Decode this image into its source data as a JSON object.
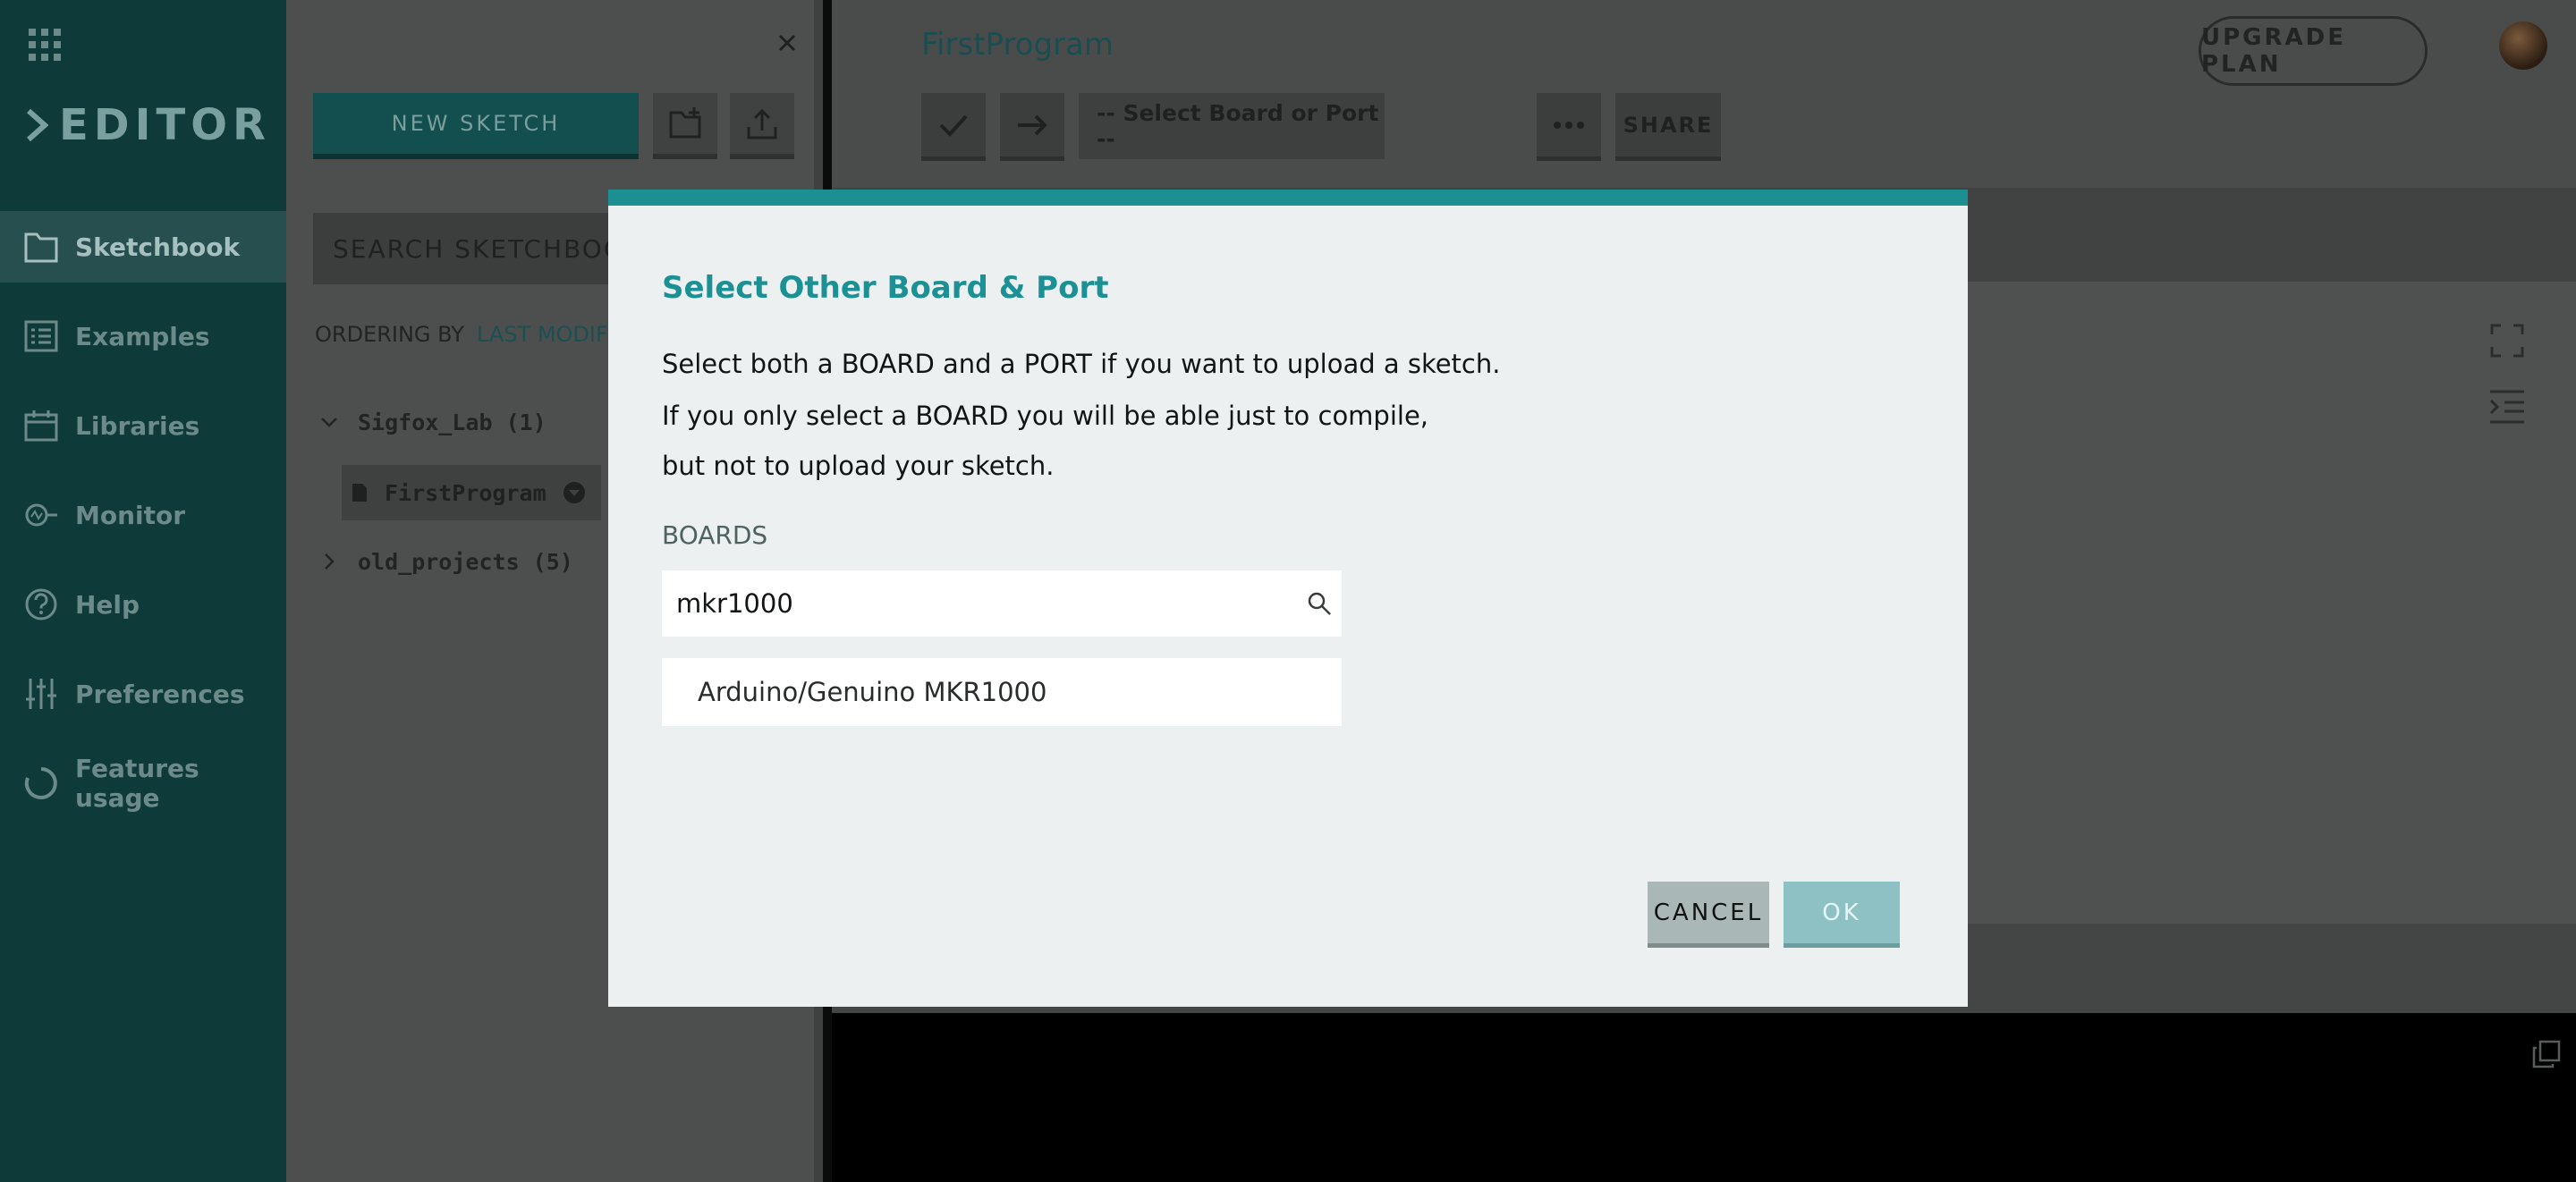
{
  "brand": {
    "name": "EDITOR"
  },
  "nav": {
    "items": [
      {
        "label": "Sketchbook",
        "icon": "folder-icon"
      },
      {
        "label": "Examples",
        "icon": "list-icon"
      },
      {
        "label": "Libraries",
        "icon": "library-icon"
      },
      {
        "label": "Monitor",
        "icon": "monitor-icon"
      },
      {
        "label": "Help",
        "icon": "help-icon"
      },
      {
        "label": "Preferences",
        "icon": "sliders-icon"
      },
      {
        "label": "Features usage",
        "icon": "usage-icon"
      }
    ],
    "active": "Sketchbook"
  },
  "sketchbook": {
    "new_sketch_label": "NEW SKETCH",
    "search_label": "SEARCH SKETCHBOOK",
    "ordering_label": "ORDERING BY",
    "ordering_value": "LAST MODIFIE",
    "folders": [
      {
        "name": "Sigfox_Lab (1)",
        "expanded": true
      },
      {
        "name": "old_projects (5)",
        "expanded": false
      }
    ],
    "file": "FirstProgram"
  },
  "editor": {
    "sketch_title": "FirstProgram",
    "upgrade_label": "UPGRADE PLAN",
    "board_select_label": "-- Select Board or Port --",
    "share_label": "SHARE"
  },
  "modal": {
    "title": "Select Other Board & Port",
    "line1": "Select both a BOARD and a PORT if you want to upload a sketch.",
    "line2": "If you only select a BOARD you will be able just to compile,",
    "line3": "but not to upload your sketch.",
    "boards_label": "BOARDS",
    "board_query": "mkr1000",
    "result": "Arduino/Genuino MKR1000",
    "cancel_label": "CANCEL",
    "ok_label": "OK"
  },
  "colors": {
    "accent": "#1c8f93",
    "rail": "#0f3a3a",
    "overlay_panel": "#4d4f4f",
    "modal_bg": "#ecf0f0"
  }
}
